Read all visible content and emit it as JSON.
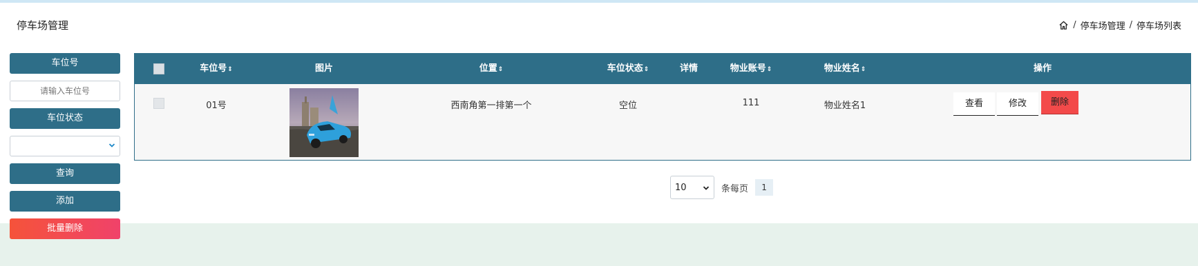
{
  "header": {
    "title": "停车场管理",
    "breadcrumb": [
      "停车场管理",
      "停车场列表"
    ]
  },
  "sidebar": {
    "plate_label": "车位号",
    "plate_placeholder": "请输入车位号",
    "status_label": "车位状态",
    "status_value": "",
    "query_button": "查询",
    "add_button": "添加",
    "batch_delete_button": "批量删除"
  },
  "table": {
    "columns": [
      "车位号",
      "图片",
      "位置",
      "车位状态",
      "详情",
      "物业账号",
      "物业姓名",
      "操作"
    ],
    "sort_glyph": "⇕",
    "rows": [
      {
        "plate": "01号",
        "image": "blue-sports-car",
        "location": "西南角第一排第一个",
        "status": "空位",
        "account": "111",
        "name": "物业姓名1",
        "actions": {
          "view": "查看",
          "edit": "修改",
          "delete": "删除"
        }
      }
    ]
  },
  "pagination": {
    "page_size": "10",
    "per_page_label": "条每页",
    "current_page": "1"
  },
  "colors": {
    "primary": "#2e6e88",
    "danger": "#f34a4a",
    "band": "#e7f2ec"
  }
}
